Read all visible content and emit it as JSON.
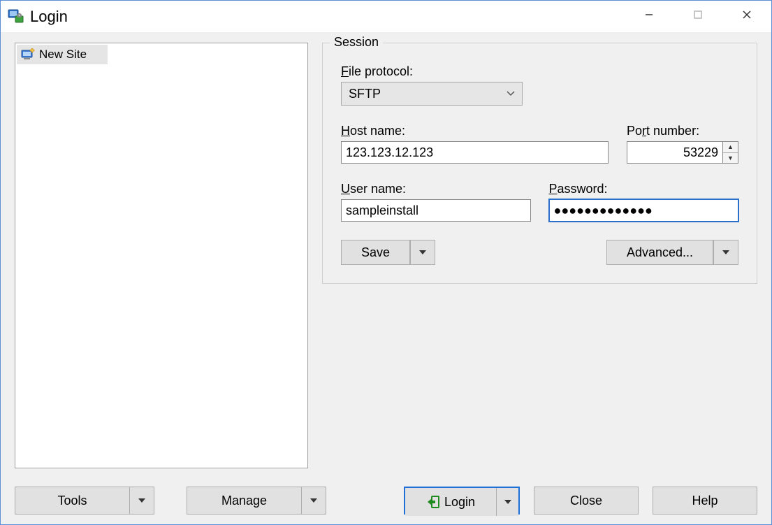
{
  "window": {
    "title": "Login"
  },
  "sites": {
    "new_site_label": "New Site"
  },
  "session": {
    "group_title": "Session",
    "file_protocol_label": "File protocol:",
    "file_protocol_value": "SFTP",
    "host_label": "Host name:",
    "host_value": "123.123.12.123",
    "port_label": "Port number:",
    "port_value": "53229",
    "user_label": "User name:",
    "user_value": "sampleinstall",
    "password_label": "Password:",
    "password_value": "●●●●●●●●●●●●●",
    "save_label": "Save",
    "advanced_label": "Advanced..."
  },
  "buttons": {
    "tools": "Tools",
    "manage": "Manage",
    "login": "Login",
    "close": "Close",
    "help": "Help"
  }
}
